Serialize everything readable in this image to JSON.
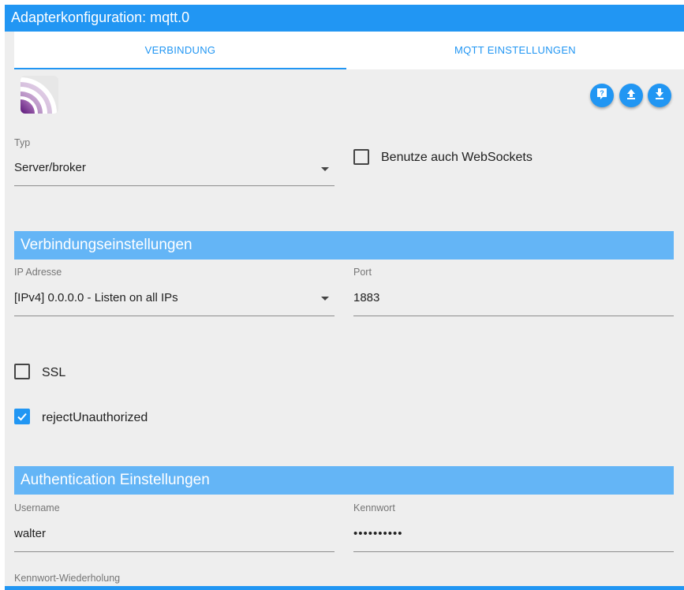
{
  "window": {
    "title": "Adapterkonfiguration: mqtt.0"
  },
  "tabs": [
    {
      "label": "VERBINDUNG",
      "active": true
    },
    {
      "label": "MQTT EINSTELLUNGEN",
      "active": false
    }
  ],
  "header_buttons": [
    {
      "icon": "help-icon"
    },
    {
      "icon": "upload-icon"
    },
    {
      "icon": "download-icon"
    }
  ],
  "type_field": {
    "label": "Typ",
    "value": "Server/broker"
  },
  "websockets": {
    "label": "Benutze auch WebSockets",
    "checked": false
  },
  "connection_section": {
    "title": "Verbindungseinstellungen"
  },
  "ip_field": {
    "label": "IP Adresse",
    "value": "[IPv4] 0.0.0.0 - Listen on all IPs"
  },
  "port_field": {
    "label": "Port",
    "value": "1883"
  },
  "ssl": {
    "label": "SSL",
    "checked": false
  },
  "reject_unauthorized": {
    "label": "rejectUnauthorized",
    "checked": true
  },
  "auth_section": {
    "title": "Authentication Einstellungen"
  },
  "username_field": {
    "label": "Username",
    "value": "walter"
  },
  "password_field": {
    "label": "Kennwort",
    "value": "••••••••••"
  },
  "password_repeat_field": {
    "label": "Kennwort-Wiederholung"
  },
  "colors": {
    "primary": "#2196f3",
    "section": "#64b5f6",
    "background": "#eeeeee"
  }
}
